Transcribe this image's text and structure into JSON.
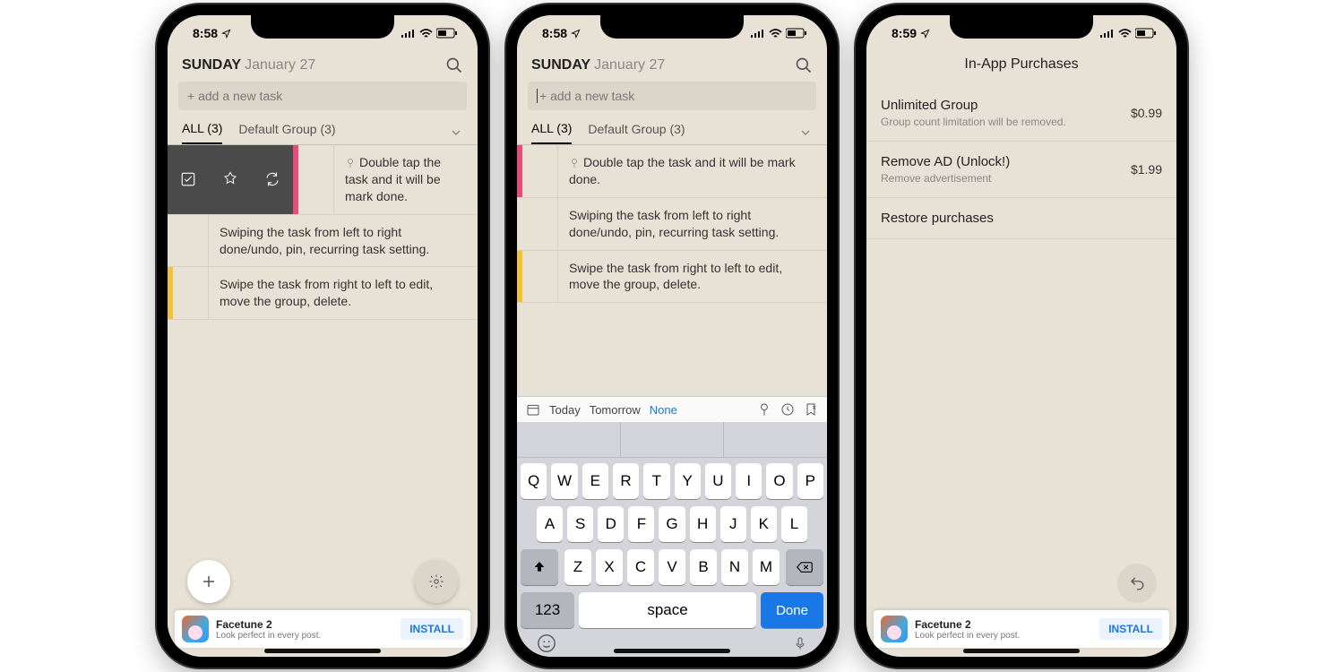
{
  "status": {
    "time_a": "8:58",
    "time_b": "8:58",
    "time_c": "8:59"
  },
  "header": {
    "day_of_week": "SUNDAY",
    "month_day": "January 27"
  },
  "add_task_placeholder": "+ add a new task",
  "tabs": {
    "all": "ALL (3)",
    "default_group": "Default Group (3)"
  },
  "tasks": [
    {
      "text": "Double tap the task and it will be mark done.",
      "pinned": true,
      "color": "#e54b7b"
    },
    {
      "text": "Swiping the task from left to right done/undo, pin, recurring task setting.",
      "pinned": false,
      "color": ""
    },
    {
      "text": "Swipe the task from right to left to edit, move the group, delete.",
      "pinned": false,
      "color": "#f4c430"
    }
  ],
  "task1_short": "Double tap the task and it will be mark done.",
  "kb_toolbar": {
    "today": "Today",
    "tomorrow": "Tomorrow",
    "none": "None"
  },
  "keyboard": {
    "row1": [
      "Q",
      "W",
      "E",
      "R",
      "T",
      "Y",
      "U",
      "I",
      "O",
      "P"
    ],
    "row2": [
      "A",
      "S",
      "D",
      "F",
      "G",
      "H",
      "J",
      "K",
      "L"
    ],
    "row3": [
      "Z",
      "X",
      "C",
      "V",
      "B",
      "N",
      "M"
    ],
    "num": "123",
    "space": "space",
    "done": "Done"
  },
  "iap": {
    "title": "In-App Purchases",
    "items": [
      {
        "title": "Unlimited Group",
        "sub": "Group count limitation will be removed.",
        "price": "$0.99"
      },
      {
        "title": "Remove AD (Unlock!)",
        "sub": "Remove advertisement",
        "price": "$1.99"
      }
    ],
    "restore": "Restore purchases"
  },
  "ad": {
    "title": "Facetune 2",
    "sub": "Look perfect in every post.",
    "button": "INSTALL"
  }
}
